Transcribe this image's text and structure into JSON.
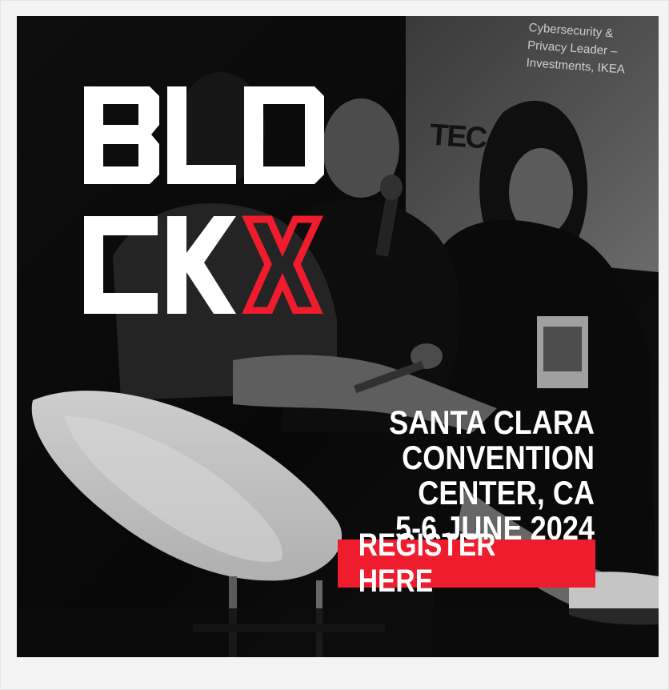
{
  "banner": {
    "caption_text": "Cybersecurity &\nPrivacy Leader –\nInvestments, IKEA",
    "slide_word": "TEC",
    "logo_text": "BLOCKX",
    "venue_line_1": "SANTA CLARA CONVENTION",
    "venue_line_2": "CENTER, CA",
    "date_line": "5-6 JUNE 2024",
    "register_label": "REGISTER HERE",
    "colors": {
      "accent_red": "#ef1c2d",
      "logo_white": "#ffffff",
      "background": "#0d0d0d"
    },
    "icons": {
      "logo": "blockx-logo-icon"
    }
  }
}
